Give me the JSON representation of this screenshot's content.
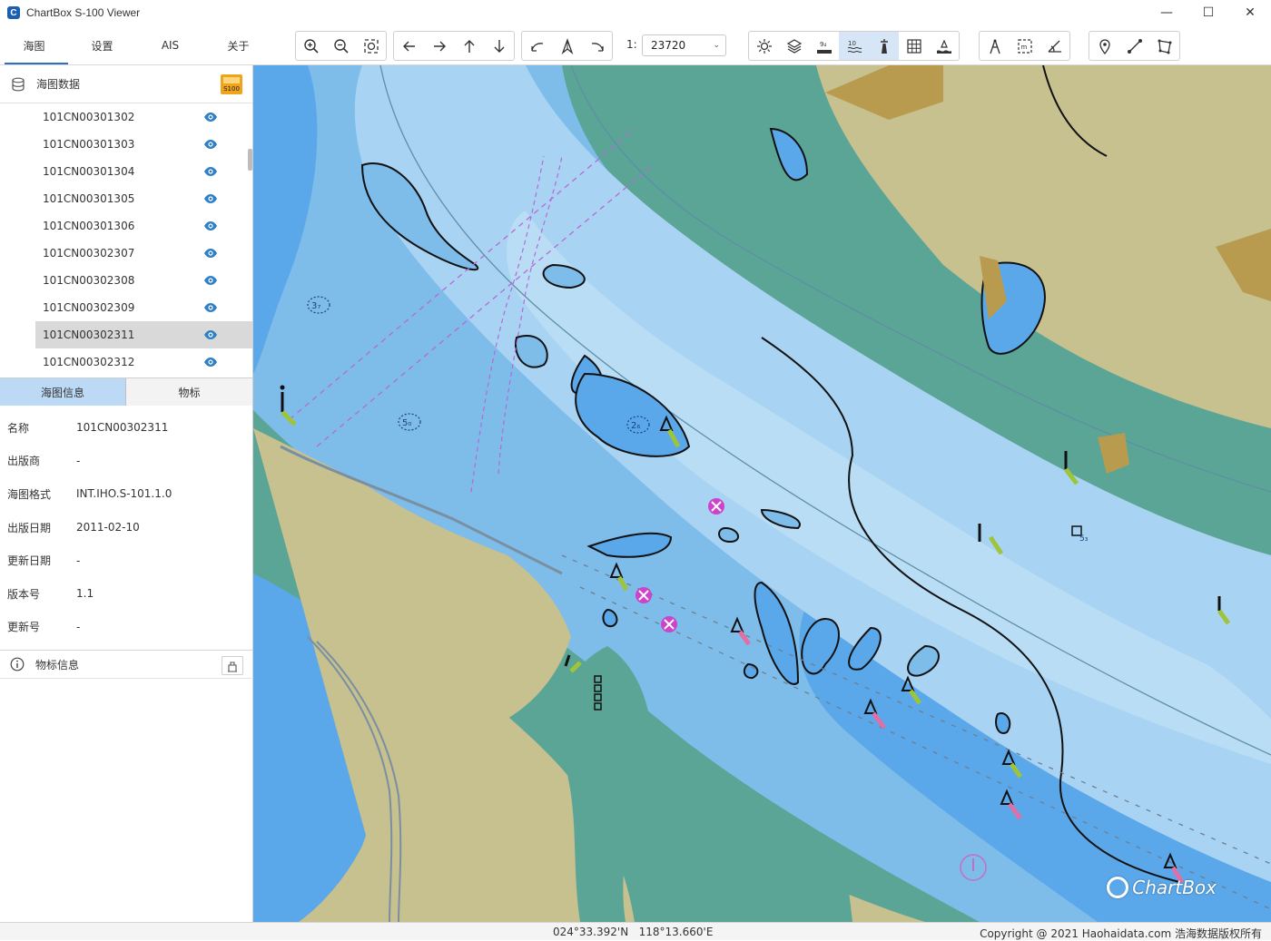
{
  "window": {
    "title": "ChartBox S-100 Viewer",
    "icon_letter": "C"
  },
  "menu": [
    "海图",
    "设置",
    "AIS",
    "关于"
  ],
  "toolbar": {
    "scale_prefix": "1:",
    "scale_value": "23720",
    "groups": [
      [
        "zoom-in-icon",
        "zoom-out-icon",
        "zoom-fit-icon"
      ],
      [
        "arrow-left-icon",
        "arrow-right-icon",
        "arrow-up-icon",
        "arrow-down-icon"
      ],
      [
        "rotate-left-icon",
        "north-up-icon",
        "rotate-right-icon"
      ],
      [
        "brightness-icon",
        "layers-icon",
        "depth-icon",
        "depth-label-icon",
        "lighthouse-icon",
        "grid-icon",
        "danger-icon"
      ],
      [
        "compass-icon",
        "measure-icon",
        "angle-icon"
      ],
      [
        "pin-icon",
        "line-icon",
        "polygon-icon"
      ]
    ]
  },
  "left_panel": {
    "header": "海图数据",
    "badge": "S100",
    "charts": [
      "101CN00301302",
      "101CN00301303",
      "101CN00301304",
      "101CN00301305",
      "101CN00301306",
      "101CN00302307",
      "101CN00302308",
      "101CN00302309",
      "101CN00302311",
      "101CN00302312"
    ],
    "selected_chart": "101CN00302311",
    "tabs": [
      "海图信息",
      "物标"
    ],
    "info": [
      {
        "k": "名称",
        "v": "101CN00302311"
      },
      {
        "k": "出版商",
        "v": "-"
      },
      {
        "k": "海图格式",
        "v": "INT.IHO.S-101.1.0"
      },
      {
        "k": "出版日期",
        "v": "2011-02-10"
      },
      {
        "k": "更新日期",
        "v": "-"
      },
      {
        "k": "版本号",
        "v": "1.1"
      },
      {
        "k": "更新号",
        "v": "-"
      }
    ],
    "object_info": "物标信息"
  },
  "map": {
    "soundings": [
      "3₇",
      "5₀",
      "2₆",
      "5₃"
    ],
    "brand": "ChartBox",
    "colors": {
      "land": "#c7c08f",
      "shallow": "#5aa596",
      "deep": "#a9d3f2",
      "mid": "#7ebcea",
      "darkblue": "#5aa8ea"
    }
  },
  "status": {
    "lat": "024°33.392'N",
    "lon": "118°13.660'E",
    "copyright": "Copyright @ 2021 Haohaidata.com 浩海数据版权所有"
  }
}
